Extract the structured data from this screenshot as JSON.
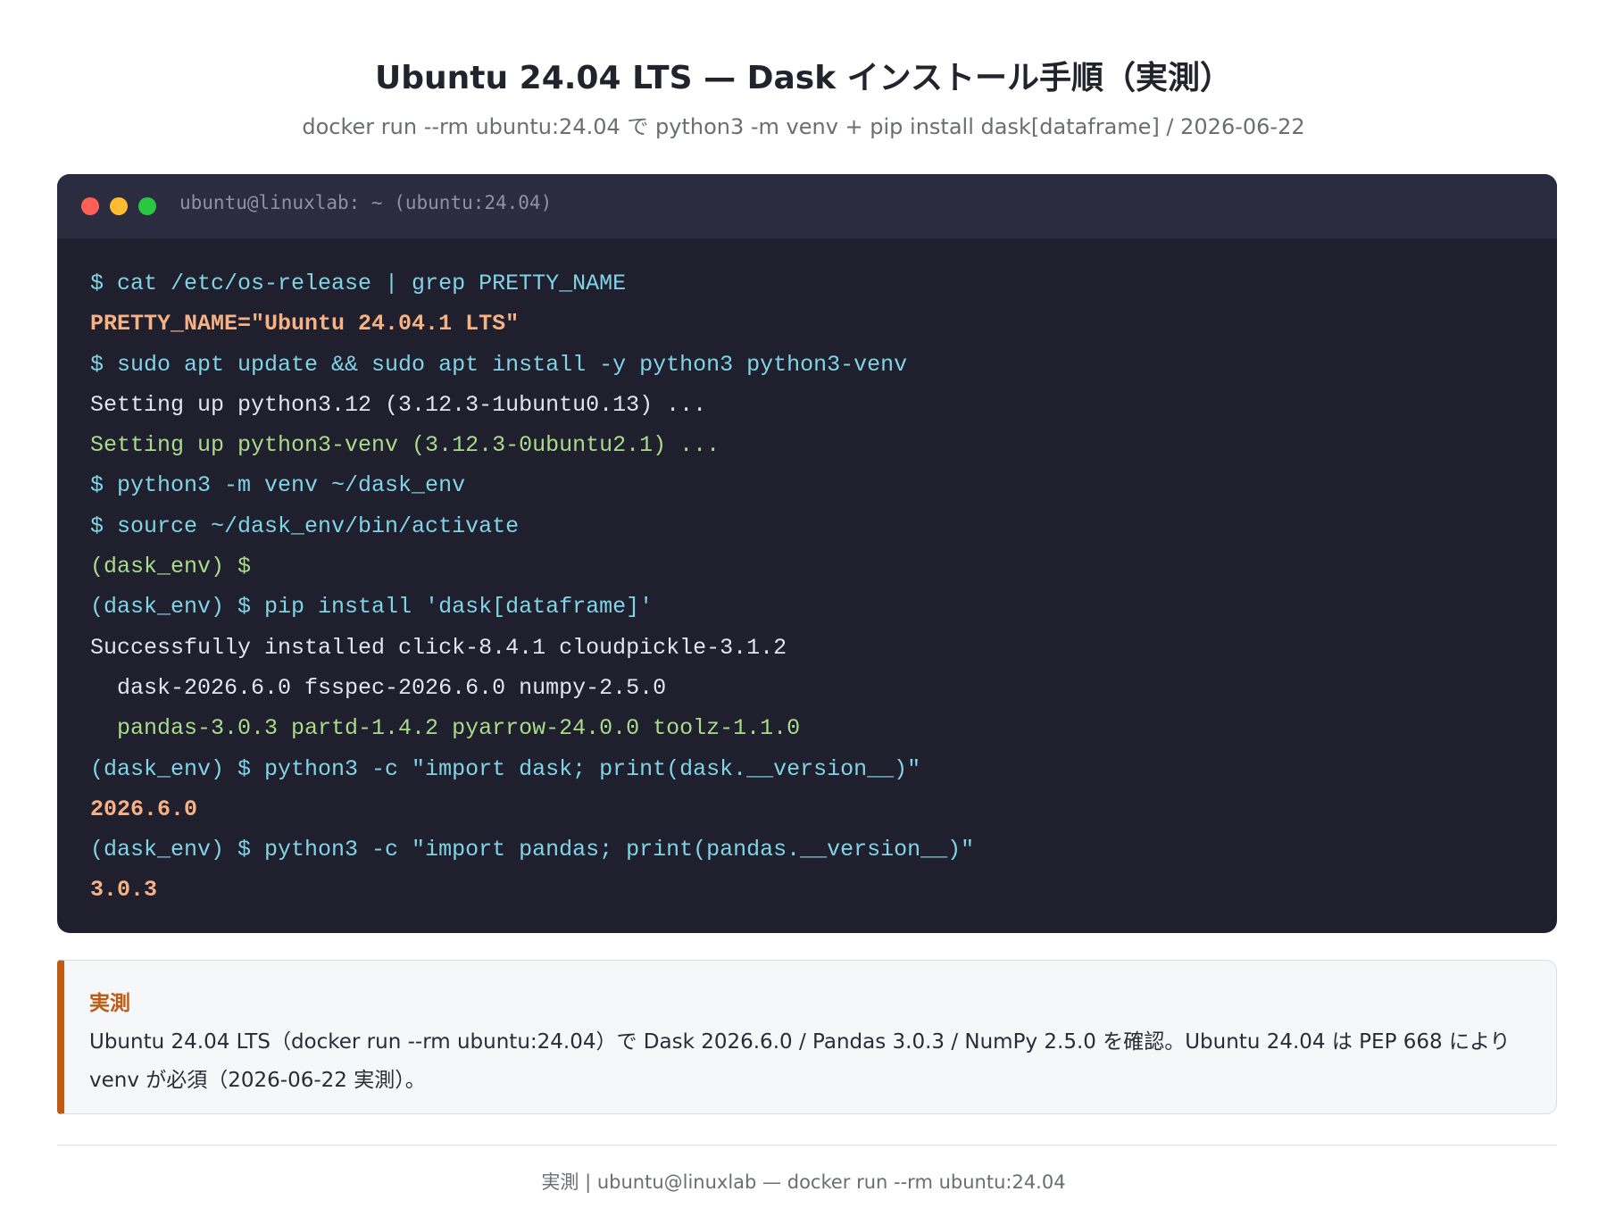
{
  "header": {
    "title": "Ubuntu 24.04 LTS — Dask インストール手順（実測）",
    "subtitle": "docker run --rm ubuntu:24.04 で python3 -m venv + pip install dask[dataframe] / 2026-06-22"
  },
  "terminal": {
    "window_title": "ubuntu@linuxlab: ~ (ubuntu:24.04)",
    "colors": {
      "command": "#7fd4e6",
      "output": "#e4e4ec",
      "success": "#a8dc8a",
      "highlight": "#f6b285",
      "background": "#1f1f2e",
      "titlebar": "#2c2c40"
    },
    "lines": [
      {
        "kind": "cmd",
        "text": "$ cat /etc/os-release | grep PRETTY_NAME"
      },
      {
        "kind": "hl",
        "text": "PRETTY_NAME=\"Ubuntu 24.04.1 LTS\""
      },
      {
        "kind": "cmd",
        "text": "$ sudo apt update && sudo apt install -y python3 python3-venv"
      },
      {
        "kind": "out",
        "text": "Setting up python3.12 (3.12.3-1ubuntu0.13) ..."
      },
      {
        "kind": "ok",
        "text": "Setting up python3-venv (3.12.3-0ubuntu2.1) ..."
      },
      {
        "kind": "cmd",
        "text": "$ python3 -m venv ~/dask_env"
      },
      {
        "kind": "cmd",
        "text": "$ source ~/dask_env/bin/activate"
      },
      {
        "kind": "ok",
        "text": "(dask_env) $"
      },
      {
        "kind": "cmd",
        "text": "(dask_env) $ pip install 'dask[dataframe]'"
      },
      {
        "kind": "out",
        "text": "Successfully installed click-8.4.1 cloudpickle-3.1.2"
      },
      {
        "kind": "out",
        "text": "  dask-2026.6.0 fsspec-2026.6.0 numpy-2.5.0"
      },
      {
        "kind": "ok",
        "text": "  pandas-3.0.3 partd-1.4.2 pyarrow-24.0.0 toolz-1.1.0"
      },
      {
        "kind": "cmd",
        "text": "(dask_env) $ python3 -c \"import dask; print(dask.__version__)\""
      },
      {
        "kind": "hl",
        "text": "2026.6.0"
      },
      {
        "kind": "cmd",
        "text": "(dask_env) $ python3 -c \"import pandas; print(pandas.__version__)\""
      },
      {
        "kind": "hl",
        "text": "3.0.3"
      }
    ]
  },
  "note": {
    "label": "実測",
    "text": "Ubuntu 24.04 LTS（docker run --rm ubuntu:24.04）で Dask 2026.6.0 / Pandas 3.0.3 / NumPy 2.5.0 を確認。Ubuntu 24.04 は PEP 668 により venv が必須（2026-06-22 実測）。",
    "accent_color": "#c05b14"
  },
  "footer": {
    "text": "実測 | ubuntu@linuxlab — docker run --rm ubuntu:24.04"
  }
}
